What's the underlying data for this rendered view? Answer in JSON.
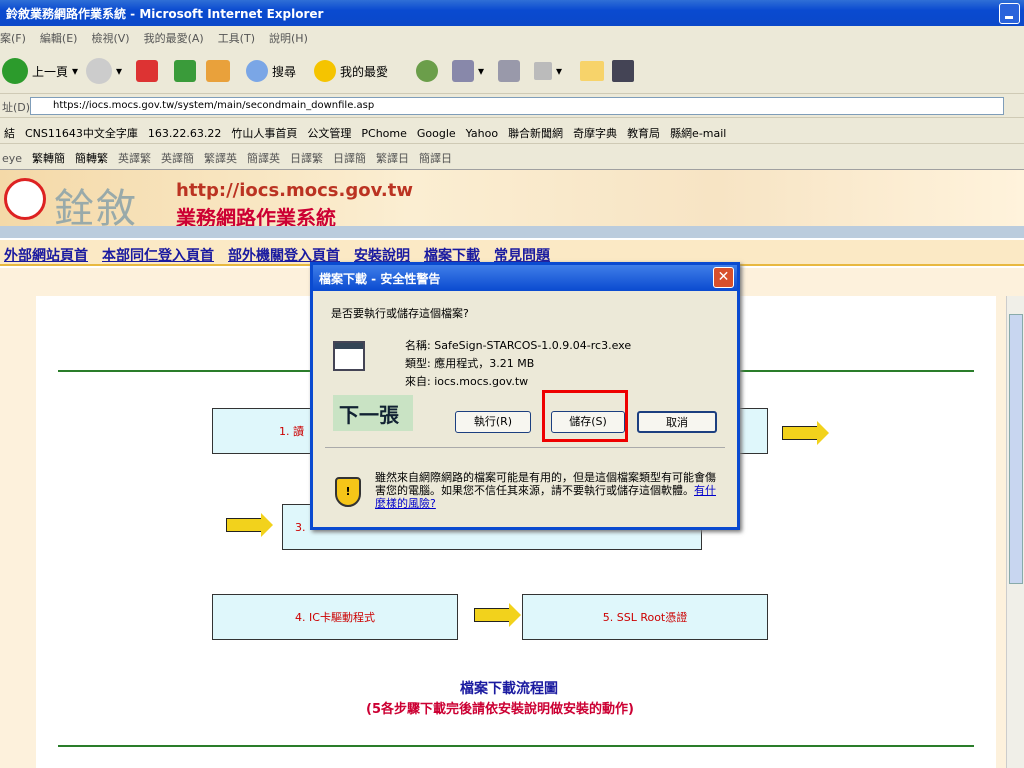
{
  "window": {
    "title": "鈴敘業務網路作業系統 - Microsoft Internet Explorer"
  },
  "menu": [
    "案(F)",
    "編輯(E)",
    "檢視(V)",
    "我的最愛(A)",
    "工具(T)",
    "說明(H)"
  ],
  "toolbar": {
    "back": "上一頁",
    "search": "搜尋",
    "favorites": "我的最愛"
  },
  "address": {
    "label": "址(D)",
    "url": "https://iocs.mocs.gov.tw/system/main/secondmain_downfile.asp"
  },
  "links": [
    "結",
    "CNS11643中文全字庫",
    "163.22.63.22",
    "竹山人事首頁",
    "公文管理",
    "PChome",
    "Google",
    "Yahoo",
    "聯合新聞網",
    "奇摩字典",
    "教育局",
    "縣網e-mail"
  ],
  "eye": [
    "eye",
    "繁轉簡",
    "簡轉繁",
    "英譯繁",
    "英譯簡",
    "繁譯英",
    "簡譯英",
    "日譯繁",
    "日譯簡",
    "繁譯日",
    "簡譯日"
  ],
  "banner": {
    "logo_text": "銓敘",
    "url": "http://iocs.mocs.gov.tw",
    "name": "業務網路作業系統"
  },
  "nav": [
    "外部網站頁首",
    "本部同仁登入頁首",
    "部外機關登入頁首",
    "安裝說明",
    "檔案下載",
    "常見問題"
  ],
  "flow": {
    "step1": "1. 讀",
    "step3": "3.",
    "step4": "4. IC卡驅動程式",
    "step5": "5. SSL Root憑證",
    "title": "檔案下載流程圖",
    "subtitle": "(5各步驟下載完後請依安裝說明做安裝的動作)"
  },
  "dialog": {
    "title": "檔案下載 - 安全性警告",
    "question": "是否要執行或儲存這個檔案?",
    "name_label": "名稱:",
    "name": "SafeSign-STARCOS-1.0.9.04-rc3.exe",
    "type_label": "類型:",
    "type": "應用程式，3.21 MB",
    "from_label": "來自:",
    "from": "iocs.mocs.gov.tw",
    "next": "下一張",
    "run": "執行(R)",
    "save": "儲存(S)",
    "cancel": "取消",
    "warning": "雖然來自網際網路的檔案可能是有用的，但是這個檔案類型有可能會傷害您的電腦。如果您不信任其來源，請不要執行或儲存這個軟體。",
    "risk_link": "有什麼樣的風險?"
  }
}
